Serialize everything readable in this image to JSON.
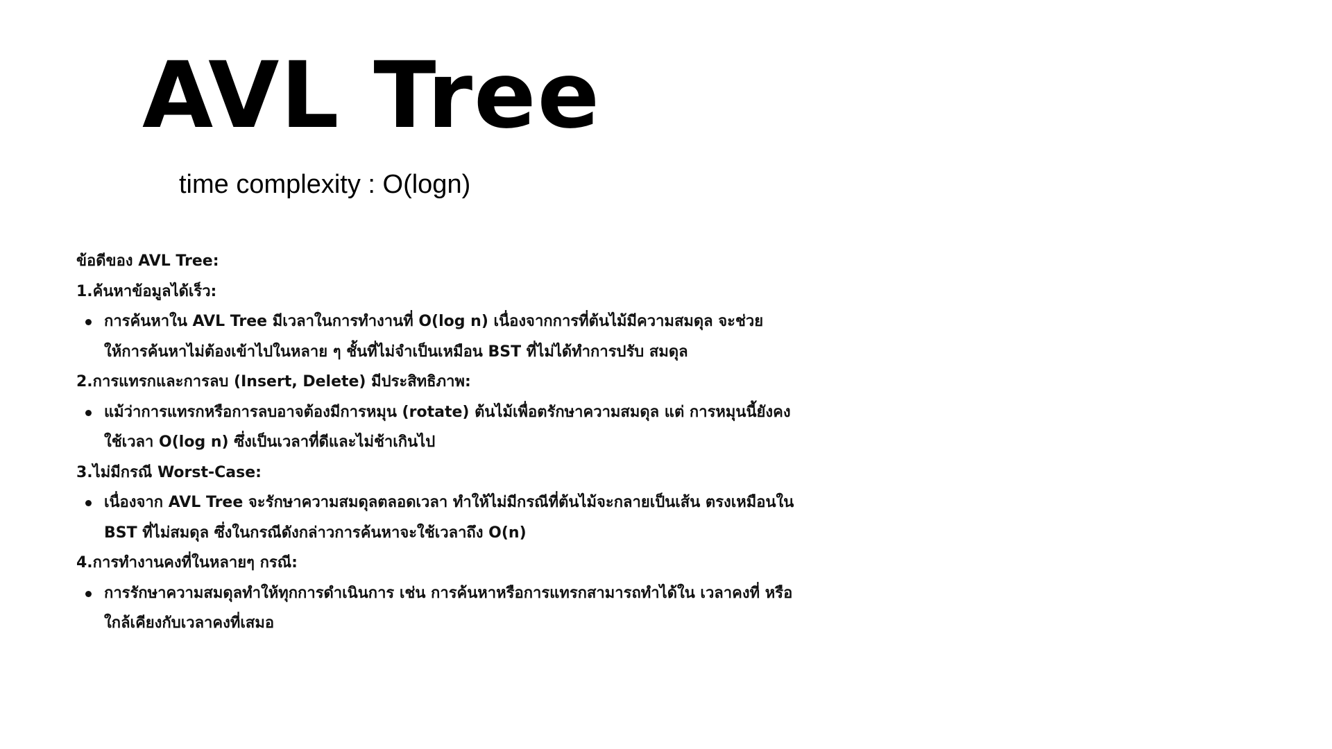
{
  "slide": {
    "title": "AVL Tree",
    "subtitle": "time complexity : O(logn)",
    "heading": "ข้อดีของ AVL Tree:",
    "sections": [
      {
        "title": "1.ค้นหาข้อมูลได้เร็ว:",
        "bullets": [
          "การค้นหาใน AVL Tree มีเวลาในการทำงานที่ O(log n) เนื่องจากการที่ต้นไม้มีความสมดุล จะช่วยให้การค้นหาไม่ต้องเข้าไปในหลาย ๆ ชั้นที่ไม่จำเป็นเหมือน BST ที่ไม่ได้ทำการปรับ สมดุล"
        ]
      },
      {
        "title": "2.การแทรกและการลบ (Insert, Delete) มีประสิทธิภาพ:",
        "bullets": [
          "แม้ว่าการแทรกหรือการลบอาจต้องมีการหมุน (rotate) ต้นไม้เพื่อตรักษาความสมดุล แต่ การหมุนนี้ยังคงใช้เวลา O(log n) ซึ่งเป็นเวลาที่ดีและไม่ช้าเกินไป"
        ]
      },
      {
        "title": "3.ไม่มีกรณี Worst-Case:",
        "bullets": [
          "เนื่องจาก AVL Tree จะรักษาความสมดุลตลอดเวลา ทำให้ไม่มีกรณีที่ต้นไม้จะกลายเป็นเส้น ตรงเหมือนใน BST ที่ไม่สมดุล ซึ่งในกรณีดังกล่าวการค้นหาจะใช้เวลาถึง O(n)"
        ]
      },
      {
        "title": "4.การทำงานคงที่ในหลายๆ กรณี:",
        "bullets": [
          "การรักษาความสมดุลทำให้ทุกการดำเนินการ เช่น การค้นหาหรือการแทรกสามารถทำได้ใน เวลาคงที่ หรือใกล้เคียงกับเวลาคงที่เสมอ"
        ]
      }
    ]
  }
}
